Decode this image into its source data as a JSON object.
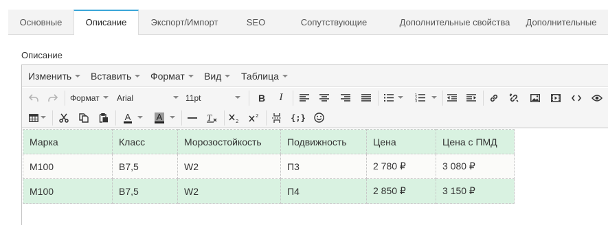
{
  "tabs": [
    {
      "label": "Основные",
      "active": false
    },
    {
      "label": "Описание",
      "active": true
    },
    {
      "label": "Экспорт/Импорт",
      "active": false
    },
    {
      "label": "SEO",
      "active": false
    },
    {
      "label": "Сопутствующие",
      "active": false
    },
    {
      "label": "Дополнительные свойства",
      "active": false
    },
    {
      "label": "Дополнительные",
      "active": false
    }
  ],
  "field_label": "Описание",
  "menubar": {
    "edit": "Изменить",
    "insert": "Вставить",
    "format": "Формат",
    "view": "Вид",
    "table": "Таблица"
  },
  "toolbar": {
    "format_select": "Формат",
    "font_select": "Arial",
    "size_select": "11pt",
    "bold": "B",
    "italic": "I",
    "code_tag": "{;}"
  },
  "icons": {
    "undo": "undo-icon",
    "redo": "redo-icon",
    "align_left": "align-left-icon",
    "align_center": "align-center-icon",
    "align_right": "align-right-icon",
    "justify": "align-justify-icon",
    "bullet_list": "bullet-list-icon",
    "numbered_list": "numbered-list-icon",
    "outdent": "outdent-icon",
    "indent": "indent-icon",
    "link": "link-icon",
    "unlink": "unlink-icon",
    "image": "image-icon",
    "media": "media-icon",
    "source": "source-code-icon",
    "preview": "preview-icon",
    "table": "table-icon",
    "cut": "cut-icon",
    "copy": "copy-icon",
    "paste": "paste-icon",
    "text_color": "text-color-icon",
    "bg_color": "background-color-icon",
    "hr": "horizontal-rule-icon",
    "clear_format": "clear-formatting-icon",
    "subscript": "subscript-icon",
    "superscript": "superscript-icon",
    "pagebreak": "page-break-icon",
    "emoticons": "emoticons-icon"
  },
  "table": {
    "rows": [
      [
        "Марка",
        "Класс",
        "Морозостойкость",
        "Подвижность",
        "Цена",
        "Цена с ПМД"
      ],
      [
        "М100",
        "В7,5",
        "W2",
        "П3",
        "2 780 ₽",
        "3 080 ₽"
      ],
      [
        "М100",
        "В7,5",
        "W2",
        "П4",
        "2 850 ₽",
        "3 150 ₽"
      ]
    ]
  },
  "colors": {
    "accent": "#3aa6d8",
    "row_highlight": "#d9f2e1",
    "text_color_underline": "#222222",
    "bg_color_swatch": "#9a9a9a"
  }
}
